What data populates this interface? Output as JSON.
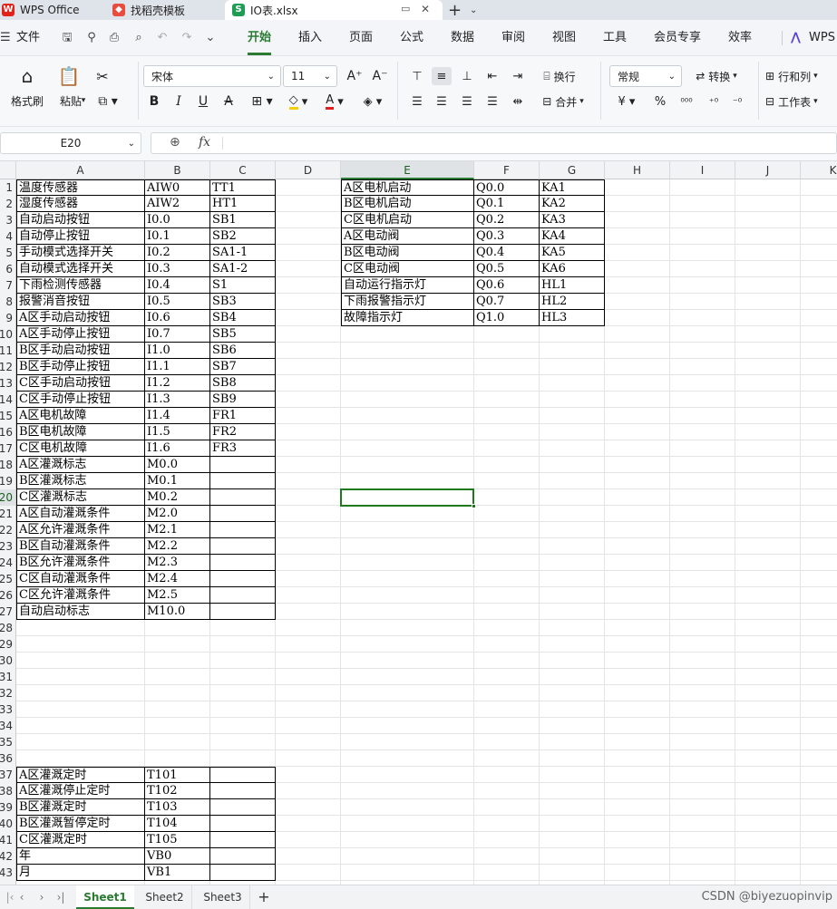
{
  "window_tabs": [
    {
      "label": "WPS Office",
      "icon": "wps-logo-icon"
    },
    {
      "label": "找稻壳模板",
      "icon": "docer-icon"
    },
    {
      "label": "IO表.xlsx",
      "icon": "spreadsheet-icon"
    }
  ],
  "menu": {
    "file": "文件",
    "tabs": [
      "开始",
      "插入",
      "页面",
      "公式",
      "数据",
      "审阅",
      "视图",
      "工具",
      "会员专享",
      "效率"
    ],
    "active_tab": "开始",
    "wps_ai": "WPS"
  },
  "ribbon": {
    "format_painter": "格式刷",
    "paste": "粘贴",
    "font_name": "宋体",
    "font_size": "11",
    "wrap": "换行",
    "merge": "合并",
    "number_format": "常规",
    "convert": "转换",
    "row_col": "行和列",
    "worksheet": "工作表"
  },
  "formula_bar": {
    "name_box": "E20",
    "fx": "fx",
    "value": ""
  },
  "columns": [
    "A",
    "B",
    "C",
    "D",
    "E",
    "F",
    "G",
    "H",
    "I",
    "J",
    "K"
  ],
  "row_numbers": [
    "1",
    "2",
    "3",
    "4",
    "5",
    "6",
    "7",
    "8",
    "9",
    "10",
    "11",
    "12",
    "13",
    "14",
    "15",
    "16",
    "17",
    "18",
    "19",
    "20",
    "21",
    "22",
    "23",
    "24",
    "25",
    "26",
    "27",
    "28",
    "29",
    "30",
    "31",
    "32",
    "33",
    "34",
    "35",
    "36",
    "37",
    "38",
    "39",
    "40",
    "41",
    "42",
    "43"
  ],
  "table_left": [
    [
      "温度传感器",
      "AIW0",
      "TT1"
    ],
    [
      "湿度传感器",
      "AIW2",
      "HT1"
    ],
    [
      "自动启动按钮",
      "I0.0",
      "SB1"
    ],
    [
      "自动停止按钮",
      "I0.1",
      "SB2"
    ],
    [
      "手动模式选择开关",
      "I0.2",
      "SA1-1"
    ],
    [
      "自动模式选择开关",
      "I0.3",
      "SA1-2"
    ],
    [
      "下雨检测传感器",
      "I0.4",
      "S1"
    ],
    [
      "报警消音按钮",
      "I0.5",
      "SB3"
    ],
    [
      "A区手动启动按钮",
      "I0.6",
      "SB4"
    ],
    [
      "A区手动停止按钮",
      "I0.7",
      "SB5"
    ],
    [
      "B区手动启动按钮",
      "I1.0",
      "SB6"
    ],
    [
      "B区手动停止按钮",
      "I1.1",
      "SB7"
    ],
    [
      "C区手动启动按钮",
      "I1.2",
      "SB8"
    ],
    [
      "C区手动停止按钮",
      "I1.3",
      "SB9"
    ],
    [
      "A区电机故障",
      "I1.4",
      "FR1"
    ],
    [
      "B区电机故障",
      "I1.5",
      "FR2"
    ],
    [
      "C区电机故障",
      "I1.6",
      "FR3"
    ],
    [
      "A区灌溉标志",
      "M0.0",
      ""
    ],
    [
      "B区灌溉标志",
      "M0.1",
      ""
    ],
    [
      "C区灌溉标志",
      "M0.2",
      ""
    ],
    [
      "A区自动灌溉条件",
      "M2.0",
      ""
    ],
    [
      "A区允许灌溉条件",
      "M2.1",
      ""
    ],
    [
      "B区自动灌溉条件",
      "M2.2",
      ""
    ],
    [
      "B区允许灌溉条件",
      "M2.3",
      ""
    ],
    [
      "C区自动灌溉条件",
      "M2.4",
      ""
    ],
    [
      "C区允许灌溉条件",
      "M2.5",
      ""
    ],
    [
      "自动启动标志",
      "M10.0",
      ""
    ]
  ],
  "table_right": [
    [
      "A区电机启动",
      "Q0.0",
      "KA1"
    ],
    [
      "B区电机启动",
      "Q0.1",
      "KA2"
    ],
    [
      "C区电机启动",
      "Q0.2",
      "KA3"
    ],
    [
      "A区电动阀",
      "Q0.3",
      "KA4"
    ],
    [
      "B区电动阀",
      "Q0.4",
      "KA5"
    ],
    [
      "C区电动阀",
      "Q0.5",
      "KA6"
    ],
    [
      "自动运行指示灯",
      "Q0.6",
      "HL1"
    ],
    [
      "下雨报警指示灯",
      "Q0.7",
      "HL2"
    ],
    [
      "故障指示灯",
      "Q1.0",
      "HL3"
    ]
  ],
  "table_timers": [
    [
      "A区灌溉定时",
      "T101",
      ""
    ],
    [
      "A区灌溉停止定时",
      "T102",
      ""
    ],
    [
      "B区灌溉定时",
      "T103",
      ""
    ],
    [
      "B区灌溉暂停定时",
      "T104",
      ""
    ],
    [
      "C区灌溉定时",
      "T105",
      ""
    ],
    [
      "年",
      "VB0",
      ""
    ],
    [
      "月",
      "VB1",
      ""
    ]
  ],
  "sheets": [
    "Sheet1",
    "Sheet2",
    "Sheet3"
  ],
  "active_sheet": "Sheet1",
  "watermark": "CSDN @biyezuopinvip",
  "colors": {
    "accent": "#2a7a32",
    "selection": "#1f7a1f"
  }
}
